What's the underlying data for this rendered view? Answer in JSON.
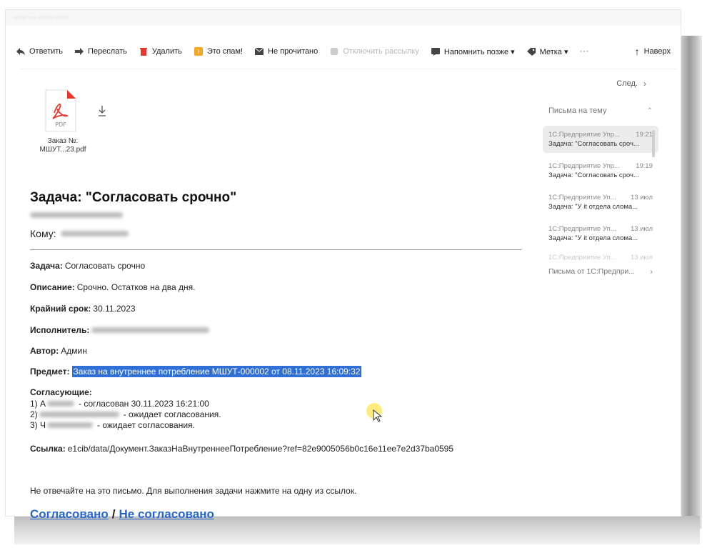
{
  "toolbar": {
    "reply": "Ответить",
    "forward": "Переслать",
    "delete": "Удалить",
    "spam": "Это спам!",
    "unread": "Не прочитано",
    "unsubscribe": "Отключить рассылку",
    "remind": "Напомнить позже ▾",
    "label": "Метка ▾",
    "more": "···",
    "top": "Наверх"
  },
  "attachment": {
    "type_label": "PDF",
    "name": "Заказ №: МШУТ...23.pdf"
  },
  "email": {
    "title": "Задача: \"Согласовать срочно\"",
    "to_label": "Кому:",
    "fields": {
      "task_label": "Задача:",
      "task_value": "Согласовать срочно",
      "description_label": "Описание:",
      "description_value": "Срочно. Остатков на два дня.",
      "deadline_label": "Крайний срок:",
      "deadline_value": "30.11.2023",
      "executor_label": "Исполнитель:",
      "author_label": "Автор:",
      "author_value": "Админ",
      "subject_label": "Предмет:",
      "subject_value": "Заказ на внутреннее потребление МШУТ-000002 от 08.11.2023 16:09:32"
    },
    "approvers": {
      "head": "Согласующие:",
      "rows": [
        {
          "num": "1) А",
          "status": "- согласован 30.11.2023 16:21:00"
        },
        {
          "num": "2) ",
          "status": "- ожидает согласования."
        },
        {
          "num": "3) Ч",
          "status": "- ожидает согласования."
        }
      ]
    },
    "link_label": "Ссылка:",
    "link_value": "e1cib/data/Документ.ЗаказНаВнутреннееПотребление?ref=82e9005056b0c16e11ee7e2d37ba0595",
    "note": "Не отвечайте на это письмо. Для выполнения задачи нажмите на одну из ссылок.",
    "approve": "Согласовано",
    "separator": "/",
    "reject": "Не согласовано"
  },
  "nav": {
    "next": "След.",
    "next_icon": "chevron-right-icon"
  },
  "thread_panel": {
    "title": "Письма на тему",
    "items": [
      {
        "from": "1С:Предприятие Упр...",
        "time": "19:21",
        "subject": "Задача: \"Согласовать сроч..."
      },
      {
        "from": "1С:Предприятие Упр...",
        "time": "19:19",
        "subject": "Задача: \"Согласовать сроч..."
      },
      {
        "from": "1С:Предприятие Уп...",
        "time": "13 июл",
        "subject": "Задача: \"У it отдела слома..."
      },
      {
        "from": "1С:Предприятие Уп...",
        "time": "13 июл",
        "subject": "Задача: \"У it отдела слома..."
      },
      {
        "from": "1С:Предприятие Уп...",
        "time": "13 июл",
        "subject": ""
      }
    ],
    "more_from": "Письма от 1С:Предпри..."
  },
  "colors": {
    "link": "#2767c9",
    "selection": "#2f6fd6",
    "pdf_red": "#e8372c"
  }
}
